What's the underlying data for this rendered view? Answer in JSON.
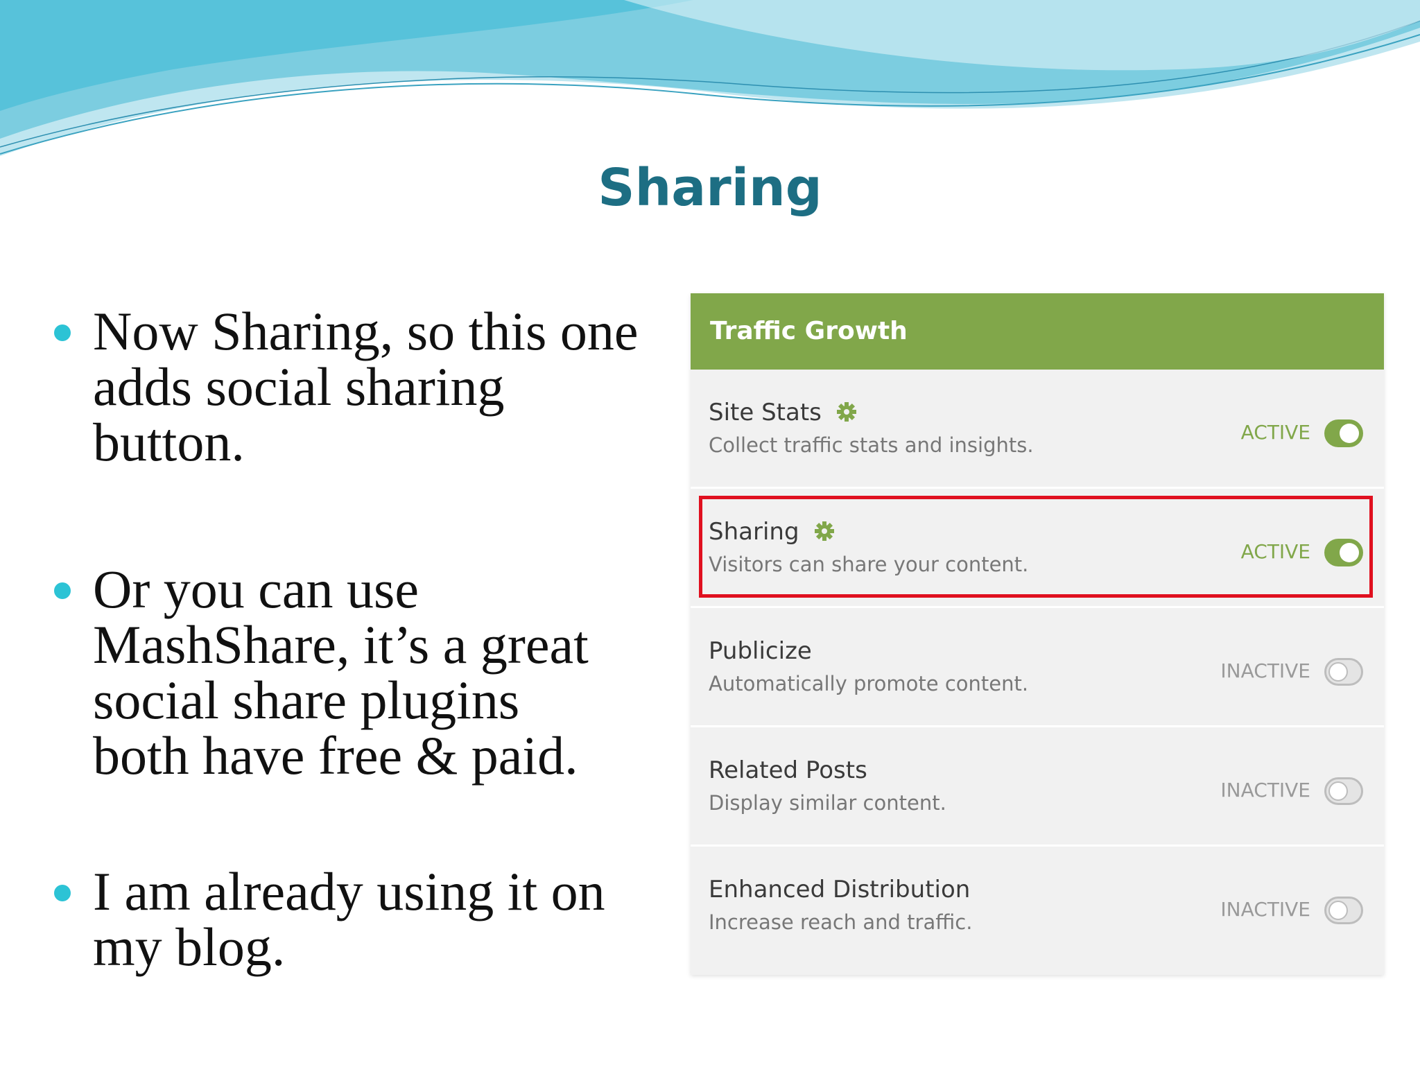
{
  "slide": {
    "title": "Sharing",
    "bullets": [
      {
        "lines": [
          "Now Sharing, so this one",
          "adds social sharing",
          "button."
        ]
      },
      {
        "lines": [
          "Or you can use",
          "MashShare, it’s a great",
          "social share plugins",
          "both have free & paid."
        ]
      },
      {
        "lines": [
          "I am already using it on",
          "my blog."
        ]
      }
    ]
  },
  "panel": {
    "title": "Traffic Growth",
    "modules": [
      {
        "name": "Site Stats",
        "description": "Collect traffic stats and insights.",
        "status": "ACTIVE",
        "active": true,
        "has_gear": true,
        "highlighted": false
      },
      {
        "name": "Sharing",
        "description": "Visitors can share your content.",
        "status": "ACTIVE",
        "active": true,
        "has_gear": true,
        "highlighted": true
      },
      {
        "name": "Publicize",
        "description": "Automatically promote content.",
        "status": "INACTIVE",
        "active": false,
        "has_gear": false,
        "highlighted": false
      },
      {
        "name": "Related Posts",
        "description": "Display similar content.",
        "status": "INACTIVE",
        "active": false,
        "has_gear": false,
        "highlighted": false
      },
      {
        "name": "Enhanced Distribution",
        "description": "Increase reach and traffic.",
        "status": "INACTIVE",
        "active": false,
        "has_gear": false,
        "highlighted": false
      }
    ]
  },
  "colors": {
    "title": "#1d6e83",
    "bullet_dot": "#2cc3d5",
    "header_green": "#81a74a",
    "highlight_red": "#e0101f",
    "wave_light": "#bfe6f0",
    "wave_dark": "#5ac0d8"
  },
  "icons": {
    "gear": "gear-icon",
    "bullet": "bullet-dot-icon"
  }
}
